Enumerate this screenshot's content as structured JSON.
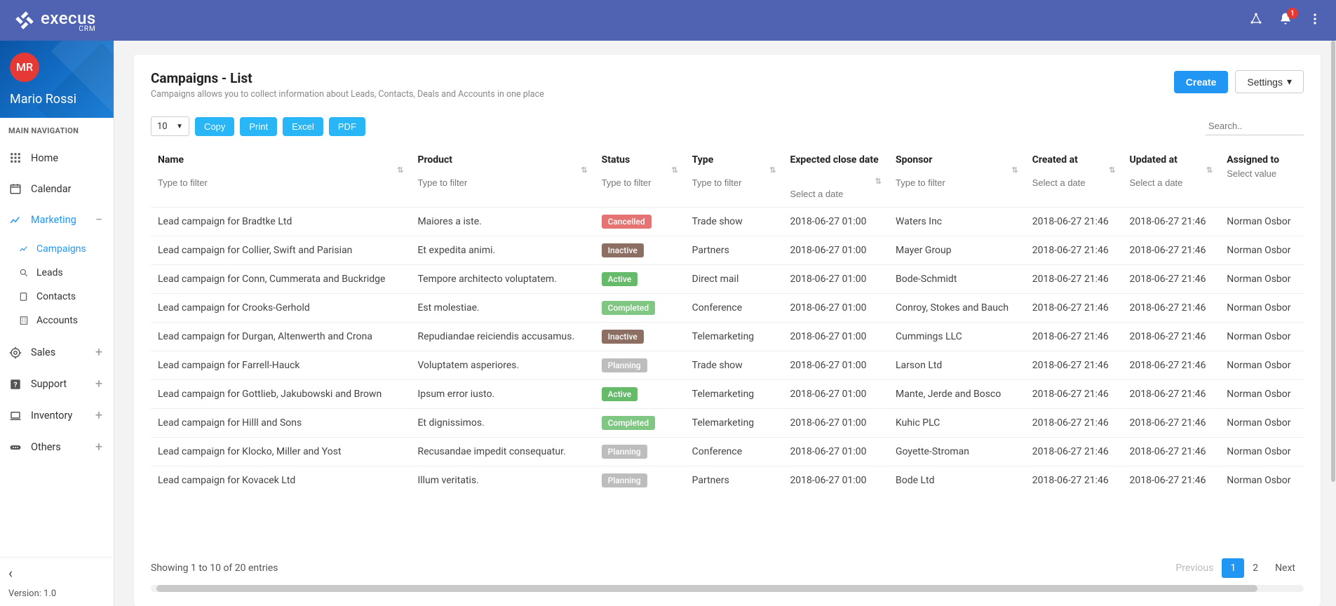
{
  "brand": {
    "name": "execus",
    "sub": "CRM"
  },
  "topbar": {
    "notification_count": "1"
  },
  "profile": {
    "initials": "MR",
    "name": "Mario Rossi"
  },
  "nav_heading": "MAIN NAVIGATION",
  "nav": {
    "home": "Home",
    "calendar": "Calendar",
    "marketing": "Marketing",
    "campaigns": "Campaigns",
    "leads": "Leads",
    "contacts": "Contacts",
    "accounts": "Accounts",
    "sales": "Sales",
    "support": "Support",
    "inventory": "Inventory",
    "others": "Others"
  },
  "version_label": "Version: 1.0",
  "page": {
    "title": "Campaigns - List",
    "subtitle": "Campaigns allows you to collect information about Leads, Contacts, Deals and Accounts in one place",
    "create": "Create",
    "settings": "Settings"
  },
  "toolbar": {
    "page_size": "10",
    "copy": "Copy",
    "print": "Print",
    "excel": "Excel",
    "pdf": "PDF",
    "search_placeholder": "Search.."
  },
  "columns": {
    "name": "Name",
    "product": "Product",
    "status": "Status",
    "type": "Type",
    "expected": "Expected close date",
    "sponsor": "Sponsor",
    "created": "Created at",
    "updated": "Updated at",
    "assigned": "Assigned to"
  },
  "filter_placeholders": {
    "text": "Type to filter",
    "date": "Select a date",
    "select": "Select value"
  },
  "rows": [
    {
      "name": "Lead campaign for Bradtke Ltd",
      "product": "Maiores a iste.",
      "status": "Cancelled",
      "type": "Trade show",
      "expected": "2018-06-27 01:00",
      "sponsor": "Waters Inc",
      "created": "2018-06-27 21:46",
      "updated": "2018-06-27 21:46",
      "assigned": "Norman Osbor"
    },
    {
      "name": "Lead campaign for Collier, Swift and Parisian",
      "product": "Et expedita animi.",
      "status": "Inactive",
      "type": "Partners",
      "expected": "2018-06-27 01:00",
      "sponsor": "Mayer Group",
      "created": "2018-06-27 21:46",
      "updated": "2018-06-27 21:46",
      "assigned": "Norman Osbor"
    },
    {
      "name": "Lead campaign for Conn, Cummerata and Buckridge",
      "product": "Tempore architecto voluptatem.",
      "status": "Active",
      "type": "Direct mail",
      "expected": "2018-06-27 01:00",
      "sponsor": "Bode-Schmidt",
      "created": "2018-06-27 21:46",
      "updated": "2018-06-27 21:46",
      "assigned": "Norman Osbor"
    },
    {
      "name": "Lead campaign for Crooks-Gerhold",
      "product": "Est molestiae.",
      "status": "Completed",
      "type": "Conference",
      "expected": "2018-06-27 01:00",
      "sponsor": "Conroy, Stokes and Bauch",
      "created": "2018-06-27 21:46",
      "updated": "2018-06-27 21:46",
      "assigned": "Norman Osbor"
    },
    {
      "name": "Lead campaign for Durgan, Altenwerth and Crona",
      "product": "Repudiandae reiciendis accusamus.",
      "status": "Inactive",
      "type": "Telemarketing",
      "expected": "2018-06-27 01:00",
      "sponsor": "Cummings LLC",
      "created": "2018-06-27 21:46",
      "updated": "2018-06-27 21:46",
      "assigned": "Norman Osbor"
    },
    {
      "name": "Lead campaign for Farrell-Hauck",
      "product": "Voluptatem asperiores.",
      "status": "Planning",
      "type": "Trade show",
      "expected": "2018-06-27 01:00",
      "sponsor": "Larson Ltd",
      "created": "2018-06-27 21:46",
      "updated": "2018-06-27 21:46",
      "assigned": "Norman Osbor"
    },
    {
      "name": "Lead campaign for Gottlieb, Jakubowski and Brown",
      "product": "Ipsum error iusto.",
      "status": "Active",
      "type": "Telemarketing",
      "expected": "2018-06-27 01:00",
      "sponsor": "Mante, Jerde and Bosco",
      "created": "2018-06-27 21:46",
      "updated": "2018-06-27 21:46",
      "assigned": "Norman Osbor"
    },
    {
      "name": "Lead campaign for Hilll and Sons",
      "product": "Et dignissimos.",
      "status": "Completed",
      "type": "Telemarketing",
      "expected": "2018-06-27 01:00",
      "sponsor": "Kuhic PLC",
      "created": "2018-06-27 21:46",
      "updated": "2018-06-27 21:46",
      "assigned": "Norman Osbor"
    },
    {
      "name": "Lead campaign for Klocko, Miller and Yost",
      "product": "Recusandae impedit consequatur.",
      "status": "Planning",
      "type": "Conference",
      "expected": "2018-06-27 01:00",
      "sponsor": "Goyette-Stroman",
      "created": "2018-06-27 21:46",
      "updated": "2018-06-27 21:46",
      "assigned": "Norman Osbor"
    },
    {
      "name": "Lead campaign for Kovacek Ltd",
      "product": "Illum veritatis.",
      "status": "Planning",
      "type": "Partners",
      "expected": "2018-06-27 01:00",
      "sponsor": "Bode Ltd",
      "created": "2018-06-27 21:46",
      "updated": "2018-06-27 21:46",
      "assigned": "Norman Osbor"
    }
  ],
  "footer": {
    "info": "Showing 1 to 10 of 20 entries",
    "previous": "Previous",
    "page1": "1",
    "page2": "2",
    "next": "Next"
  }
}
